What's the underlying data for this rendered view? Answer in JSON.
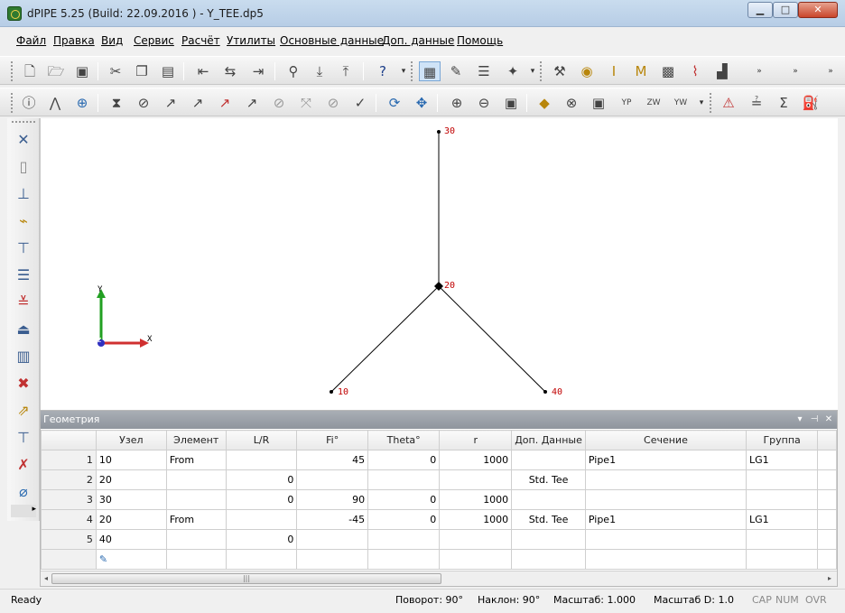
{
  "window": {
    "title": "dPIPE 5.25 (Build: 22.09.2016 ) - Y_TEE.dp5",
    "minimize": "▁",
    "maximize": "□",
    "close": "✕"
  },
  "menu": [
    "Файл",
    "Правка",
    "Вид",
    "Сервис",
    "Расчёт",
    "Утилиты",
    "Основные данные",
    "Доп. данные",
    "Помощь"
  ],
  "canvas": {
    "node_labels": [
      "30",
      "20",
      "10",
      "40"
    ],
    "axis_x": "X",
    "axis_y": "Y",
    "axis_z": "Z"
  },
  "panel": {
    "title": "Геометрия",
    "columns": [
      "Узел",
      "Элемент",
      "L/R",
      "Fi°",
      "Theta°",
      "r",
      "Доп. Данные",
      "Сечение",
      "Группа"
    ],
    "rows": [
      {
        "num": "1",
        "node": "10",
        "element": "From",
        "lr": "",
        "fi": "45",
        "theta": "0",
        "r": "1000",
        "extra": "",
        "section": "Pipe1",
        "group": "LG1"
      },
      {
        "num": "2",
        "node": "20",
        "element": "",
        "lr": "0",
        "fi": "",
        "theta": "",
        "r": "",
        "extra": "Std. Tee",
        "section": "",
        "group": ""
      },
      {
        "num": "3",
        "node": "30",
        "element": "",
        "lr": "0",
        "fi": "90",
        "theta": "0",
        "r": "1000",
        "extra": "",
        "section": "",
        "group": ""
      },
      {
        "num": "4",
        "node": "20",
        "element": "From",
        "lr": "",
        "fi": "-45",
        "theta": "0",
        "r": "1000",
        "extra": "Std. Tee",
        "section": "Pipe1",
        "group": "LG1"
      },
      {
        "num": "5",
        "node": "40",
        "element": "",
        "lr": "0",
        "fi": "",
        "theta": "",
        "r": "",
        "extra": "",
        "section": "",
        "group": ""
      }
    ]
  },
  "status": {
    "ready": "Ready",
    "rotation": "Поворот: 90°",
    "tilt": "Наклон: 90°",
    "scale": "Масштаб: 1.000",
    "scale_d": "Масштаб D: 1.0",
    "cap": "CAP",
    "num": "NUM",
    "ovr": "OVR"
  },
  "icons": {
    "toolbar1": [
      "new-file-icon",
      "open-file-icon",
      "save-icon",
      "cut-icon",
      "copy-icon",
      "paste-icon",
      "indent-left-icon",
      "indent-mid-icon",
      "indent-right-icon",
      "find-icon",
      "import-icon",
      "export-icon",
      "help-icon",
      "grid-icon",
      "edit-element-icon",
      "notes-icon",
      "wand-icon",
      "valve-icon",
      "flange-icon",
      "beam-icon",
      "m-icon",
      "dataset-icon",
      "curve-icon",
      "chart-icon"
    ],
    "toolbar2": [
      "info-icon",
      "bend-icon",
      "target-icon",
      "node-icon",
      "pencil-diag-icon",
      "draw-1-icon",
      "draw-2-icon",
      "draw-3-icon",
      "draw-4-icon",
      "draw-5-icon",
      "draw-6-icon",
      "draw-7-icon",
      "draw-8-icon",
      "rotate-icon",
      "move-icon",
      "zoom-in-icon",
      "zoom-out-icon",
      "zoom-fit-icon",
      "diamond-icon",
      "clamp-icon",
      "display-icon",
      "yp-icon",
      "zw-icon",
      "yw-icon",
      "error-check-icon",
      "query-icon",
      "sum-icon",
      "pump-icon"
    ],
    "left": [
      "cross-icon",
      "cylinder-icon",
      "anchor-icon",
      "spring-icon",
      "tee-icon",
      "reducer-icon",
      "expansion-icon",
      "nozzle-icon",
      "flange-joint-icon",
      "restraint-icon",
      "hanger-icon",
      "guide-icon",
      "valve-red-icon",
      "pipe-blue-icon"
    ]
  }
}
